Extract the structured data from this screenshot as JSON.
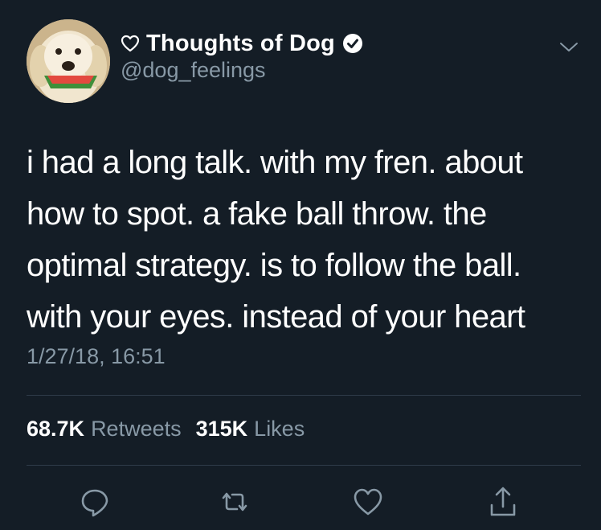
{
  "colors": {
    "background": "#141d26",
    "text_primary": "#ffffff",
    "text_secondary": "#8899a6",
    "divider": "#2f3c49",
    "icon": "#8899a6"
  },
  "author": {
    "display_name": "Thoughts of Dog",
    "handle": "@dog_feelings",
    "verified": true,
    "name_prefix_icon": "heart-outline-icon",
    "avatar": "golden-retriever-with-watermelon"
  },
  "tweet": {
    "lines": [
      "i had a long talk. with my fren. about",
      "how to spot. a fake ball throw. the",
      "optimal strategy. is to follow the ball.",
      "with your eyes. instead of your heart"
    ],
    "timestamp": "1/27/18, 16:51"
  },
  "stats": {
    "retweets_count": "68.7K",
    "retweets_label": "Retweets",
    "likes_count": "315K",
    "likes_label": "Likes"
  },
  "actions": [
    {
      "name": "reply",
      "icon": "speech-bubble-icon"
    },
    {
      "name": "retweet",
      "icon": "retweet-icon"
    },
    {
      "name": "like",
      "icon": "heart-outline-icon"
    },
    {
      "name": "share",
      "icon": "share-upload-icon"
    }
  ],
  "menu_icon": "chevron-down-icon"
}
